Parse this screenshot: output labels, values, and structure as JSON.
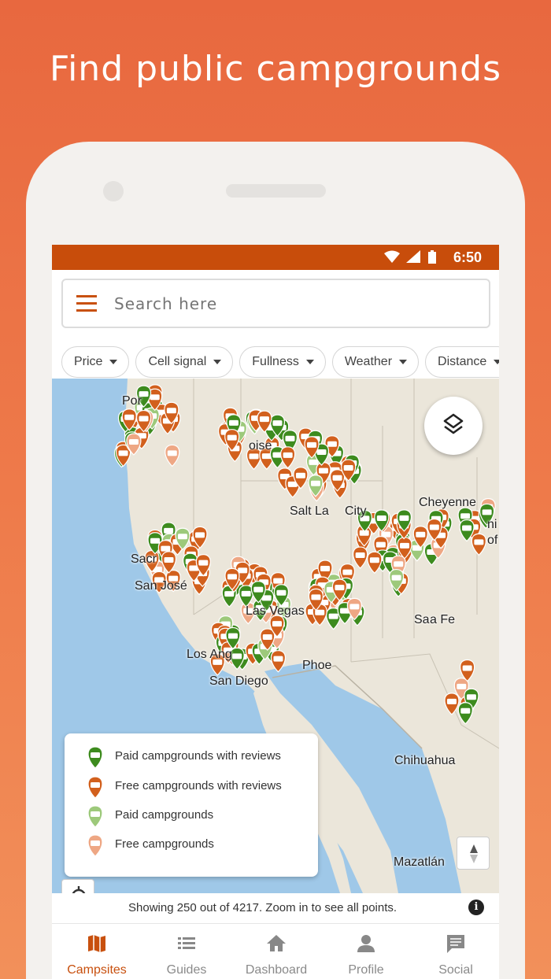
{
  "promo": {
    "headline": "Find public campgrounds"
  },
  "statusbar": {
    "time": "6:50",
    "icons": [
      "wifi-icon",
      "signal-icon",
      "battery-icon"
    ]
  },
  "search": {
    "placeholder": "Search here"
  },
  "filters": [
    "Price",
    "Cell signal",
    "Fullness",
    "Weather",
    "Distance"
  ],
  "map": {
    "cities": [
      "Por",
      "oise",
      "Salt La",
      "City",
      "Cheyenne",
      "Sacr",
      "San José",
      "Las Vegas",
      "Sa",
      "a Fe",
      "Los Ang",
      "Phoe",
      "San Diego",
      "Chihuahua",
      "Mazatlán",
      "ni",
      "of"
    ]
  },
  "legend": {
    "items": [
      {
        "label": "Paid campgrounds with reviews",
        "color": "#3d8b1e"
      },
      {
        "label": "Free campgrounds with reviews",
        "color": "#d2601d"
      },
      {
        "label": "Paid campgrounds",
        "color": "#9dc97b"
      },
      {
        "label": "Free campgrounds",
        "color": "#eea784"
      }
    ]
  },
  "info": {
    "text": "Showing 250 out of 4217. Zoom in to see all points."
  },
  "nav": {
    "items": [
      {
        "label": "Campsites",
        "icon": "map-icon",
        "active": true
      },
      {
        "label": "Guides",
        "icon": "list-icon",
        "active": false
      },
      {
        "label": "Dashboard",
        "icon": "home-icon",
        "active": false
      },
      {
        "label": "Profile",
        "icon": "person-icon",
        "active": false
      },
      {
        "label": "Social",
        "icon": "chat-icon",
        "active": false
      }
    ]
  },
  "colors": {
    "accent": "#c8500e",
    "statusbar": "#c84d0b"
  }
}
